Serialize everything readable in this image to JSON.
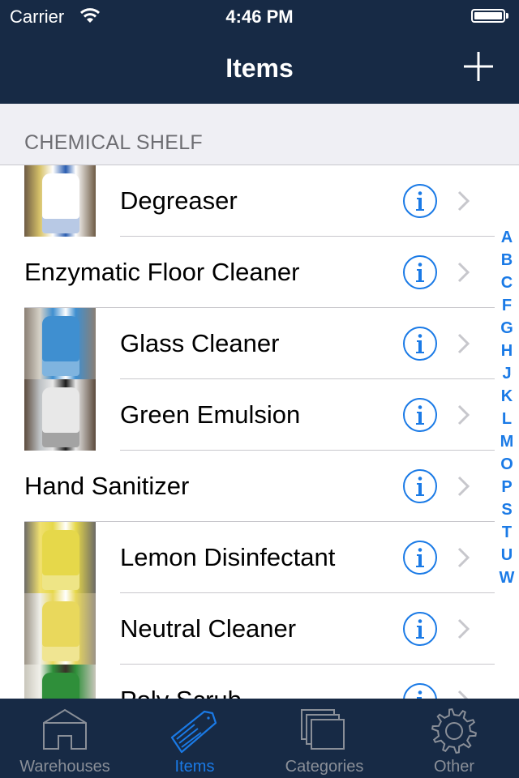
{
  "status_bar": {
    "carrier": "Carrier",
    "time": "4:46 PM",
    "battery_percent": 100
  },
  "nav": {
    "title": "Items",
    "add_icon": "plus-icon"
  },
  "section": {
    "title": "CHEMICAL SHELF"
  },
  "items": [
    {
      "name": "Degreaser",
      "has_thumbnail": true,
      "thumb_colors": [
        "#d8c36a",
        "#ffffff",
        "#2a5db0",
        "#6d5a44"
      ]
    },
    {
      "name": "Enzymatic Floor Cleaner",
      "has_thumbnail": false
    },
    {
      "name": "Glass Cleaner",
      "has_thumbnail": true,
      "thumb_colors": [
        "#d6d2c8",
        "#3f8fd0",
        "#ffffff",
        "#8a7f74"
      ]
    },
    {
      "name": "Green Emulsion",
      "has_thumbnail": true,
      "thumb_colors": [
        "#bfc3c6",
        "#e8e8e8",
        "#1b1b1b",
        "#5b4a3c"
      ]
    },
    {
      "name": "Hand Sanitizer",
      "has_thumbnail": false
    },
    {
      "name": "Lemon Disinfectant",
      "has_thumbnail": true,
      "thumb_colors": [
        "#f0e070",
        "#e6d84a",
        "#ffffff",
        "#6c6a66"
      ]
    },
    {
      "name": "Neutral Cleaner",
      "has_thumbnail": true,
      "thumb_colors": [
        "#efefe9",
        "#e9d85c",
        "#ffffff",
        "#9b9386"
      ]
    },
    {
      "name": "Poly Scrub",
      "has_thumbnail": true,
      "thumb_colors": [
        "#f1f0ea",
        "#2f8f3a",
        "#3a3028",
        "#c9c6bb"
      ]
    }
  ],
  "row_icons": {
    "info": "info-icon",
    "chevron": "chevron-right-icon"
  },
  "index_letters": [
    "A",
    "B",
    "C",
    "F",
    "G",
    "H",
    "J",
    "K",
    "L",
    "M",
    "O",
    "P",
    "S",
    "T",
    "U",
    "W"
  ],
  "tabs": [
    {
      "label": "Warehouses",
      "icon": "warehouse-icon",
      "active": false
    },
    {
      "label": "Items",
      "icon": "tag-icon",
      "active": true
    },
    {
      "label": "Categories",
      "icon": "stacked-pages-icon",
      "active": false
    },
    {
      "label": "Other",
      "icon": "gear-icon",
      "active": false
    }
  ],
  "colors": {
    "bar_background": "#172a45",
    "accent": "#1a7ae6",
    "inactive_tab": "#8a8f98",
    "section_bg": "#efeff4",
    "separator": "#c8c7cc"
  }
}
